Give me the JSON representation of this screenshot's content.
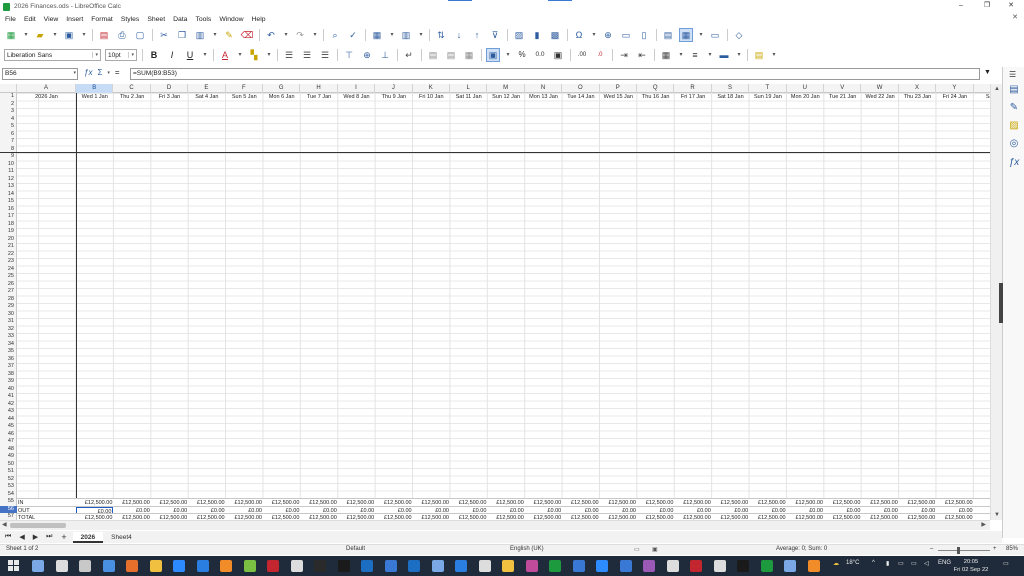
{
  "window": {
    "title": "2026 Finances.ods - LibreOffice Calc",
    "controls": [
      "–",
      "❐",
      "✕"
    ]
  },
  "menu": [
    "File",
    "Edit",
    "View",
    "Insert",
    "Format",
    "Styles",
    "Sheet",
    "Data",
    "Tools",
    "Window",
    "Help"
  ],
  "formatting": {
    "font_name": "Liberation Sans",
    "font_size": "10pt",
    "bold": "B",
    "italic": "I",
    "underline": "U",
    "font_color_glyph": "A",
    "percent": "%",
    "decimal_00": "0.0",
    "add_decimal": ".00",
    "remove_decimal": ".0"
  },
  "formula_bar": {
    "cell_ref": "B56",
    "expand_glyph": "▼",
    "formula": "=SUM(B9:B53)"
  },
  "grid": {
    "columns": [
      "A",
      "B",
      "C",
      "D",
      "E",
      "F",
      "G",
      "H",
      "I",
      "J",
      "K",
      "L",
      "M",
      "N",
      "O",
      "P",
      "Q",
      "R",
      "S",
      "T",
      "U",
      "V",
      "W",
      "X",
      "Y"
    ],
    "selected_column": "B",
    "row1_values": [
      "2026 Jan",
      "Wed 1 Jan",
      "Thu 2 Jan",
      "Fri 3 Jan",
      "Sat 4 Jan",
      "Sun 5 Jan",
      "Mon 6 Jan",
      "Tue 7 Jan",
      "Wed 8 Jan",
      "Thu 9 Jan",
      "Fri 10 Jan",
      "Sat 11 Jan",
      "Sun 12 Jan",
      "Mon 13 Jan",
      "Tue 14 Jan",
      "Wed 15 Jan",
      "Thu 16 Jan",
      "Fri 17 Jan",
      "Sat 18 Jan",
      "Sun 19 Jan",
      "Mon 20 Jan",
      "Tue 21 Jan",
      "Wed 22 Jan",
      "Thu 23 Jan",
      "Fri 24 Jan",
      "Sat 2"
    ],
    "row_numbers": [
      "1",
      "2",
      "3",
      "4",
      "5",
      "6",
      "7",
      "8",
      "9",
      "10",
      "11",
      "12",
      "13",
      "14",
      "15",
      "16",
      "17",
      "18",
      "19",
      "20",
      "21",
      "22",
      "23",
      "24",
      "25",
      "26",
      "27",
      "28",
      "29",
      "30",
      "31",
      "32",
      "33",
      "34",
      "35",
      "36",
      "37",
      "38",
      "39",
      "40",
      "41",
      "42",
      "43",
      "44",
      "45",
      "46",
      "47",
      "48",
      "49",
      "50",
      "51",
      "52",
      "53",
      "54",
      "55",
      "56",
      "57"
    ],
    "selected_row": "56",
    "summary_rows": [
      {
        "label": "IN",
        "value": "£12,500.00",
        "last": "£12"
      },
      {
        "label": "OUT",
        "value": "£0.00",
        "last": "£0"
      },
      {
        "label": "TOTAL",
        "value": "£12,500.00",
        "last": "£12"
      }
    ]
  },
  "tabs": {
    "nav": [
      "⏮",
      "◀",
      "▶",
      "⏭"
    ],
    "add": "+",
    "sheets": [
      "2026",
      "Sheet4"
    ],
    "active": "2026"
  },
  "status": {
    "sheet": "Sheet 1 of 2",
    "page_style": "Default",
    "language": "English (UK)",
    "summary": "Average: 0; Sum: 0",
    "zoom": "85%",
    "zoom_minus": "–",
    "zoom_plus": "+"
  },
  "taskbar": {
    "weather": "18°C",
    "lang": "ENG",
    "time": "20:05",
    "date": "Fri 02 Sep 22"
  },
  "colors": {
    "selection_header": "#4572c4",
    "cell_cursor": "#1e5bc6",
    "taskbar_bg": "#1f2a3a"
  }
}
